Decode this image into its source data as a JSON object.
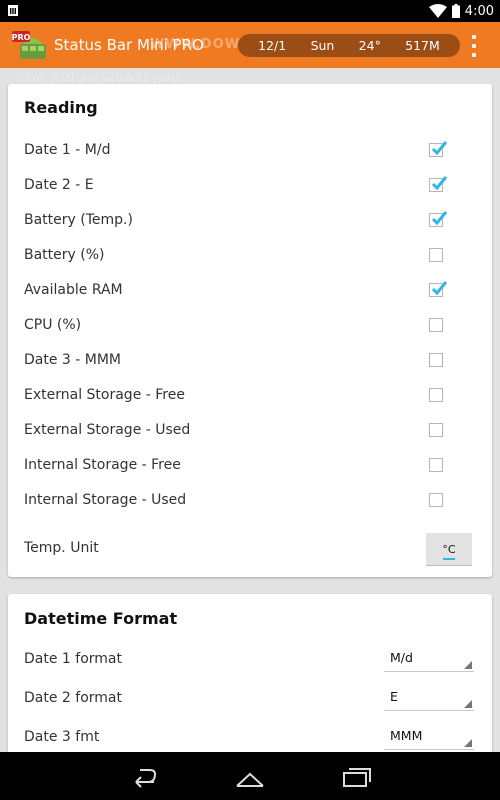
{
  "status_bar": {
    "time": "4:00",
    "icons": [
      "sim-icon",
      "wifi-icon",
      "battery-icon"
    ]
  },
  "app_bar": {
    "title": "Status Bar Mini PRO",
    "badge": "PRO",
    "watermark": "WWW.DOWNLOAD.COM",
    "watermark_fa": "اولین دانشنامه نرم افزار ایران",
    "preview": {
      "date": "12/1",
      "day": "Sun",
      "temp": "24°",
      "ram": "517M"
    },
    "menu_icon": "overflow-menu-icon"
  },
  "reading": {
    "title": "Reading",
    "items": [
      {
        "label": "Date 1 - M/d",
        "checked": true
      },
      {
        "label": "Date 2 - E",
        "checked": true
      },
      {
        "label": "Battery (Temp.)",
        "checked": true
      },
      {
        "label": "Battery (%)",
        "checked": false
      },
      {
        "label": "Available RAM",
        "checked": true
      },
      {
        "label": "CPU (%)",
        "checked": false
      },
      {
        "label": "Date 3 - MMM",
        "checked": false
      },
      {
        "label": "External Storage - Free",
        "checked": false
      },
      {
        "label": "External Storage - Used",
        "checked": false
      },
      {
        "label": "Internal Storage - Free",
        "checked": false
      },
      {
        "label": "Internal Storage - Used",
        "checked": false
      }
    ],
    "temp_unit": {
      "label": "Temp. Unit",
      "value": "°C"
    }
  },
  "datetime_format": {
    "title": "Datetime Format",
    "items": [
      {
        "label": "Date 1 format",
        "value": "M/d"
      },
      {
        "label": "Date 2 format",
        "value": "E"
      },
      {
        "label": "Date 3 fmt",
        "value": "MMM"
      }
    ]
  },
  "nav_bar": {
    "icons": [
      "back-icon",
      "home-icon",
      "recents-icon"
    ]
  },
  "colors": {
    "accent": "#f07a22",
    "check": "#33b5e5",
    "preview_bg": "#9c4d16"
  }
}
